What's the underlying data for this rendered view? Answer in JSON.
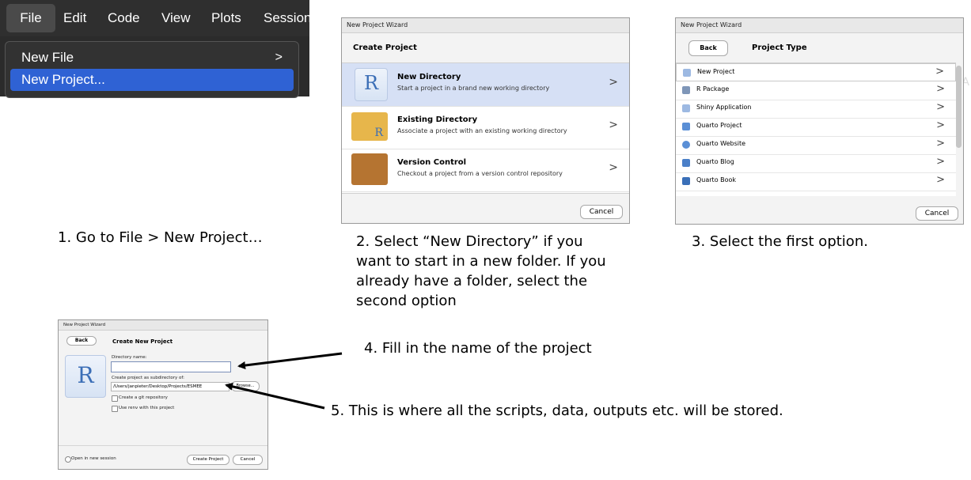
{
  "panel1": {
    "menubar": [
      "File",
      "Edit",
      "Code",
      "View",
      "Plots",
      "Session"
    ],
    "menu_items": [
      {
        "label": "New File",
        "chevron": ">"
      },
      {
        "label": "New Project..."
      }
    ],
    "side_letter": "A"
  },
  "panel2": {
    "window_title": "New Project Wizard",
    "heading": "Create Project",
    "options": [
      {
        "name": "New Directory",
        "desc": "Start a project in a brand new working directory",
        "icon": "r-logo-icon"
      },
      {
        "name": "Existing Directory",
        "desc": "Associate a project with an existing working directory",
        "icon": "folder-icon"
      },
      {
        "name": "Version Control",
        "desc": "Checkout a project from a version control repository",
        "icon": "box-icon"
      }
    ],
    "chevron": ">",
    "cancel": "Cancel",
    "r_letter": "R"
  },
  "panel3": {
    "window_title": "New Project Wizard",
    "back": "Back",
    "heading": "Project Type",
    "types": [
      "New Project",
      "R Package",
      "Shiny Application",
      "Quarto Project",
      "Quarto Website",
      "Quarto Blog",
      "Quarto Book"
    ],
    "chevron": ">",
    "cancel": "Cancel"
  },
  "panel4": {
    "window_title": "New Project Wizard",
    "back": "Back",
    "heading": "Create New Project",
    "dir_label": "Directory name:",
    "dir_value": "",
    "subdir_label": "Create project as subdirectory of:",
    "subdir_value": "/Users/janpieter/Desktop/Projects/ESMEE",
    "browse": "Browse...",
    "git_label": "Create a git repository",
    "renv_label": "Use renv with this project",
    "session_label": "Open in new session",
    "create": "Create Project",
    "cancel": "Cancel",
    "r_letter": "R"
  },
  "captions": {
    "c1": "1. Go to File > New Project…",
    "c2": [
      "2. Select “New Directory” if you",
      "want to start in a new folder. If you",
      "already have a folder, select the",
      "second option"
    ],
    "c3": "3. Select the first option.",
    "c4": "4. Fill in the name of the project",
    "c5": "5. This is where all the scripts, data, outputs etc. will be stored."
  },
  "colors": {
    "menu_highlight": "#2f62d4",
    "selected_row": "#d6e0f5",
    "r_blue": "#3b6eb6"
  }
}
